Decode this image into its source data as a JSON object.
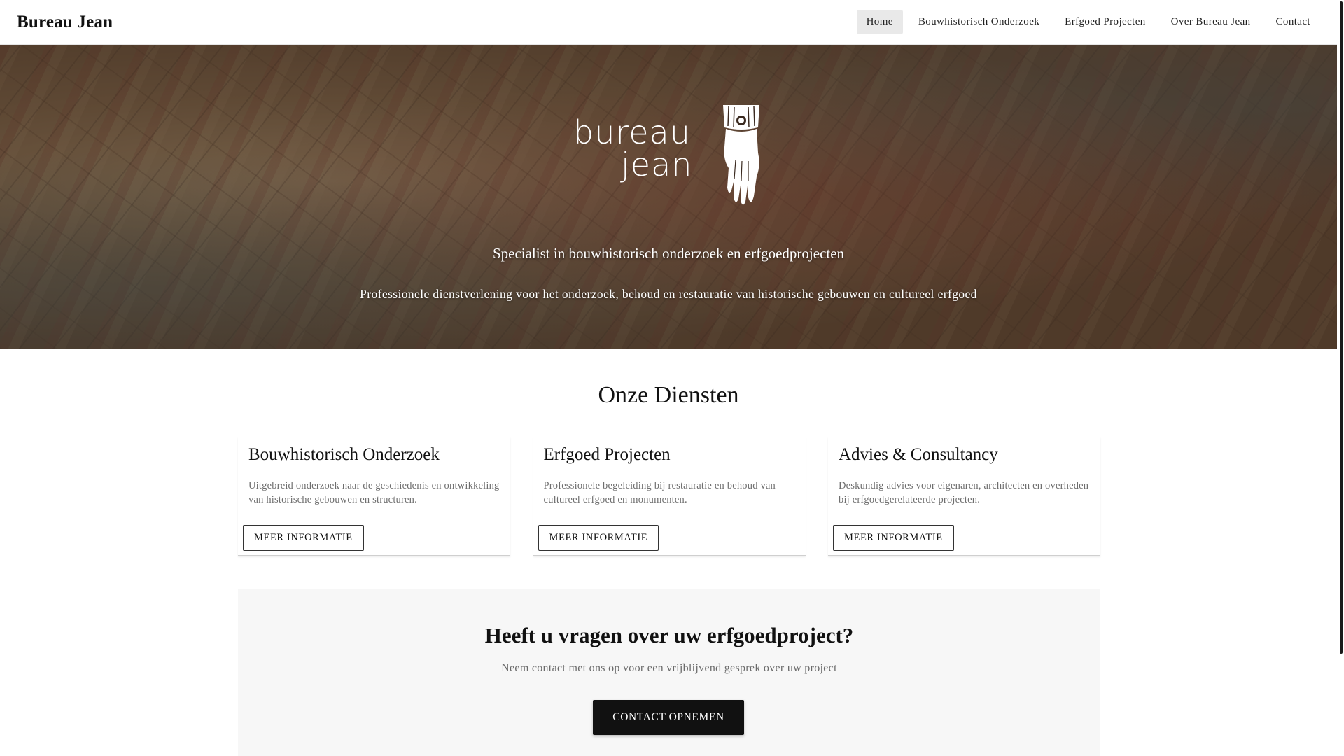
{
  "header": {
    "brand": "Bureau Jean",
    "nav": [
      {
        "label": "Home",
        "active": true
      },
      {
        "label": "Bouwhistorisch Onderzoek",
        "active": false
      },
      {
        "label": "Erfgoed Projecten",
        "active": false
      },
      {
        "label": "Over Bureau Jean",
        "active": false
      },
      {
        "label": "Contact",
        "active": false
      }
    ]
  },
  "hero": {
    "logo_line1": "bureau",
    "logo_line2": "jean",
    "subtitle": "Specialist in bouwhistorisch onderzoek en erfgoedprojecten",
    "description": "Professionele dienstverlening voor het onderzoek, behoud en restauratie van historische gebouwen en cultureel erfgoed"
  },
  "services": {
    "title": "Onze Diensten",
    "cards": [
      {
        "title": "Bouwhistorisch Onderzoek",
        "description": "Uitgebreid onderzoek naar de geschiedenis en ontwikkeling van historische gebouwen en structuren.",
        "button": "MEER INFORMATIE"
      },
      {
        "title": "Erfgoed Projecten",
        "description": "Professionele begeleiding bij restauratie en behoud van cultureel erfgoed en monumenten.",
        "button": "MEER INFORMATIE"
      },
      {
        "title": "Advies & Consultancy",
        "description": "Deskundig advies voor eigenaren, architecten en overheden bij erfgoedgerelateerde projecten.",
        "button": "MEER INFORMATIE"
      }
    ]
  },
  "cta": {
    "title": "Heeft u vragen over uw erfgoedproject?",
    "description": "Neem contact met ons op voor een vrijblijvend gesprek over uw project",
    "button": "CONTACT OPNEMEN"
  },
  "icons": {
    "logo": "hand-icon"
  },
  "colors": {
    "primary": "#111111",
    "nav_active_bg": "#e9e9e9",
    "cta_bg": "#f7f7f7",
    "muted_text": "#6e6e6e"
  }
}
